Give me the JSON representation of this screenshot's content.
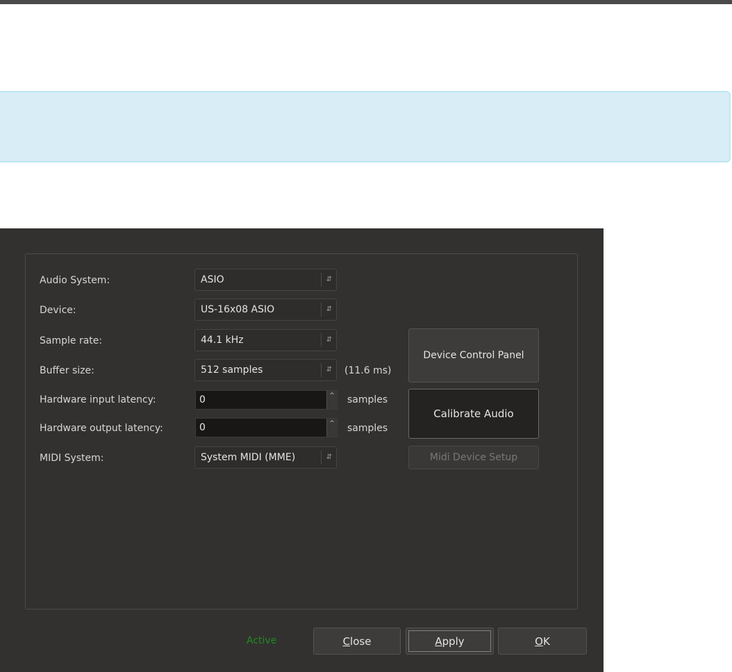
{
  "dialog": {
    "labels": {
      "audio_system": "Audio System:",
      "device": "Device:",
      "sample_rate": "Sample rate:",
      "buffer_size": "Buffer size:",
      "hw_input_latency": "Hardware input latency:",
      "hw_output_latency": "Hardware output latency:",
      "midi_system": "MIDI System:"
    },
    "values": {
      "audio_system": "ASIO",
      "device": "US-16x08 ASIO",
      "sample_rate": "44.1 kHz",
      "buffer_size": "512 samples",
      "buffer_ms": "(11.6 ms)",
      "hw_input_latency": "0",
      "hw_output_latency": "0",
      "midi_system": "System MIDI (MME)"
    },
    "units": {
      "input_latency_unit": "samples",
      "output_latency_unit": "samples"
    },
    "buttons": {
      "device_control_panel": "Device Control Panel",
      "calibrate_audio": "Calibrate Audio",
      "midi_device_setup": "Midi Device Setup",
      "close_rest": "lose",
      "close_mnemonic": "C",
      "apply_rest": "pply",
      "apply_mnemonic": "A",
      "ok_rest": "K",
      "ok_mnemonic": "O"
    },
    "status": "Active",
    "icons": {
      "combo_arrow": "updown-arrows-icon",
      "spin_up": "chevron-up-icon"
    },
    "colors": {
      "background": "#333130",
      "status_active": "#1f8a1f",
      "info_banner": "#d9edf7"
    }
  }
}
